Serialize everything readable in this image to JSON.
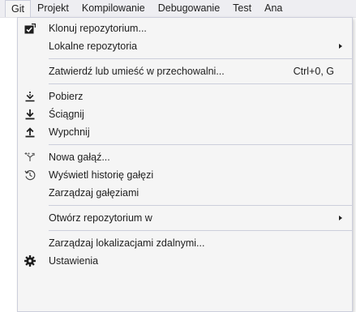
{
  "menubar": {
    "items": [
      {
        "label": "Git"
      },
      {
        "label": "Projekt"
      },
      {
        "label": "Kompilowanie"
      },
      {
        "label": "Debugowanie"
      },
      {
        "label": "Test"
      },
      {
        "label": "Ana"
      }
    ]
  },
  "git_menu": {
    "clone": {
      "label": "Klonuj repozytorium...",
      "icon": "clone-repository-icon"
    },
    "local_repos": {
      "label": "Lokalne repozytoria"
    },
    "commit": {
      "label": "Zatwierdź lub umieść w przechowalni...",
      "shortcut": "Ctrl+0, G"
    },
    "fetch": {
      "label": "Pobierz",
      "icon": "fetch-icon"
    },
    "pull": {
      "label": "Ściągnij",
      "icon": "pull-icon"
    },
    "push": {
      "label": "Wypchnij",
      "icon": "push-icon"
    },
    "new_branch": {
      "label": "Nowa gałąź...",
      "icon": "new-branch-icon"
    },
    "branch_history": {
      "label": "Wyświetl historię gałęzi",
      "icon": "history-icon"
    },
    "manage_branches": {
      "label": "Zarządzaj gałęziami"
    },
    "open_repo_in": {
      "label": "Otwórz repozytorium w"
    },
    "manage_remotes": {
      "label": "Zarządzaj lokalizacjami zdalnymi..."
    },
    "settings": {
      "label": "Ustawienia",
      "icon": "gear-icon"
    }
  },
  "colors": {
    "menubar_bg": "#eeeef2",
    "dropdown_bg": "#f5f5f5",
    "border": "#cccedb",
    "text": "#1e1e1e"
  }
}
